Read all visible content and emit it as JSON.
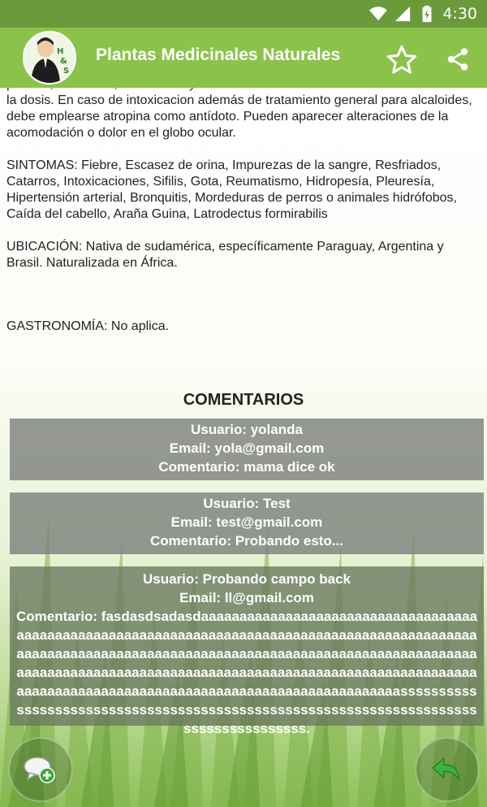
{
  "status_bar": {
    "time": "4:30",
    "icons": [
      "wifi-icon",
      "signal-icon",
      "battery-charging-icon"
    ]
  },
  "app_bar": {
    "title": "Plantas Medicinales Naturales",
    "avatar_text": "H & S",
    "actions": [
      "star-icon",
      "share-icon"
    ]
  },
  "content": {
    "paragraph_top": "profusa, temblores, bradicardia y alteraciones de la tensión arterial si se abusa de la dosis. En caso de intoxicacion además de tratamiento general para alcaloides, debe emplearse atropina como antídoto. Pueden aparecer alteraciones de la acomodación o dolor en el globo ocular.",
    "sintomas": "SINTOMAS: Fiebre, Escasez de orina, Impurezas de la sangre, Resfriados, Catarros, Intoxicaciones, Sifilis, Gota, Reumatismo, Hidropesía, Pleuresía, Hipertensión arterial, Bronquitis, Mordeduras de perros o animales hidrófobos, Caída del cabello, Araña Guina, Latrodectus formirabilis",
    "ubicacion": "UBICACIÓN: Nativa de sudamérica, específicamente Paraguay, Argentina y Brasil. Naturalizada en África.",
    "gastronomia": "GASTRONOMÍA: No aplica."
  },
  "comments": {
    "title": "COMENTARIOS",
    "items": [
      {
        "user": "Usuario: yolanda",
        "email": "Email: yola@gmail.com",
        "comment": "Comentario: mama dice ok"
      },
      {
        "user": "Usuario: Test",
        "email": "Email: test@gmail.com",
        "comment": "Comentario: Probando esto..."
      },
      {
        "user": "Usuario: Probando campo back",
        "email": "Email: ll@gmail.com",
        "comment": "Comentario: fasdasdsadasdaaaaaaaaaaaaaaaaaaaaaaaaaaaaaaaaaaaaaaaaaaaaaaaaaaaaaaaaaaaaaaaaaaaaaaaaaaaaaaaaaaaaaaaaaaaaaaaaaaaaaaaaaaaaaaaaaaaaaaaaaaaaaaaaaaaaaaaaaaaaaaaaaaaaaaaaaaaaaaaaaaaaaaaaaaaaaaaaaaaaaaaaaaaaaaaaaaaaaaaaaaaaaaaaaaaaaaaaaaaaaaaaaaaaaaaaaaaaaaaaaaaaaaaaaaaaaaaaaaaaaaaaaassssssssssssssssssssssssssssssssssssssssssssssssssssssssssssssssssssssssssssssssssssss."
      }
    ]
  },
  "fabs": {
    "left_icon": "add-comment-icon",
    "right_icon": "back-arrow-icon"
  }
}
